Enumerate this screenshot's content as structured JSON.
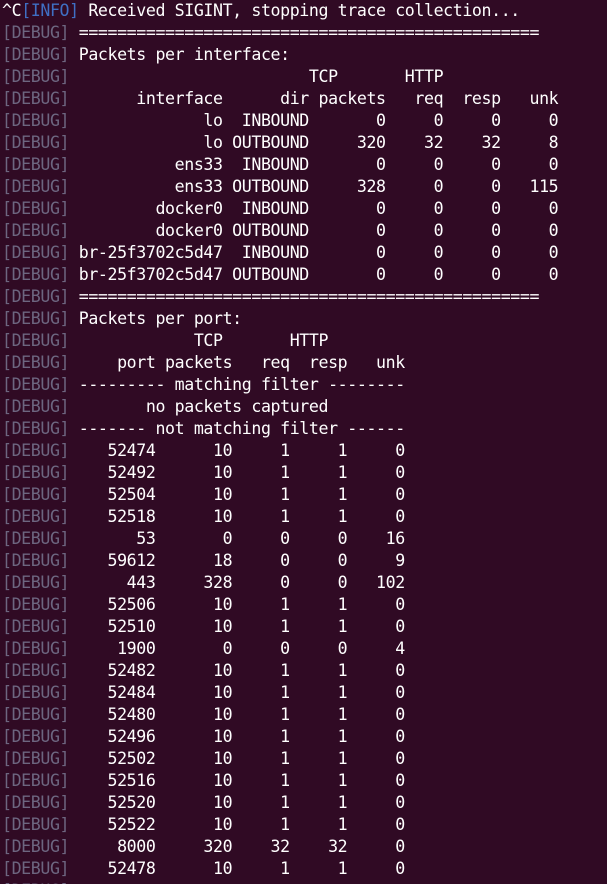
{
  "terminal": {
    "colors": {
      "background": "#300a24",
      "text": "#ffffff",
      "debug_tag": "#6d6680",
      "info_tag": "#3f6fc4"
    },
    "lines": [
      {
        "prefix": "^C",
        "tag": "[INFO]",
        "level": "info",
        "text": " Received SIGINT, stopping trace collection..."
      },
      {
        "prefix": "",
        "tag": "[DEBUG]",
        "level": "debug",
        "text": " ================================================"
      },
      {
        "prefix": "",
        "tag": "[DEBUG]",
        "level": "debug",
        "text": " Packets per interface:"
      },
      {
        "prefix": "",
        "tag": "[DEBUG]",
        "level": "debug",
        "text": "                         TCP       HTTP"
      },
      {
        "prefix": "",
        "tag": "[DEBUG]",
        "level": "debug",
        "text": "       interface      dir packets   req  resp   unk"
      },
      {
        "prefix": "",
        "tag": "[DEBUG]",
        "level": "debug",
        "text": "              lo  INBOUND       0     0     0     0"
      },
      {
        "prefix": "",
        "tag": "[DEBUG]",
        "level": "debug",
        "text": "              lo OUTBOUND     320    32    32     8"
      },
      {
        "prefix": "",
        "tag": "[DEBUG]",
        "level": "debug",
        "text": "           ens33  INBOUND       0     0     0     0"
      },
      {
        "prefix": "",
        "tag": "[DEBUG]",
        "level": "debug",
        "text": "           ens33 OUTBOUND     328     0     0   115"
      },
      {
        "prefix": "",
        "tag": "[DEBUG]",
        "level": "debug",
        "text": "         docker0  INBOUND       0     0     0     0"
      },
      {
        "prefix": "",
        "tag": "[DEBUG]",
        "level": "debug",
        "text": "         docker0 OUTBOUND       0     0     0     0"
      },
      {
        "prefix": "",
        "tag": "[DEBUG]",
        "level": "debug",
        "text": " br-25f3702c5d47  INBOUND       0     0     0     0"
      },
      {
        "prefix": "",
        "tag": "[DEBUG]",
        "level": "debug",
        "text": " br-25f3702c5d47 OUTBOUND       0     0     0     0"
      },
      {
        "prefix": "",
        "tag": "[DEBUG]",
        "level": "debug",
        "text": " ================================================"
      },
      {
        "prefix": "",
        "tag": "[DEBUG]",
        "level": "debug",
        "text": " Packets per port:"
      },
      {
        "prefix": "",
        "tag": "[DEBUG]",
        "level": "debug",
        "text": "             TCP       HTTP"
      },
      {
        "prefix": "",
        "tag": "[DEBUG]",
        "level": "debug",
        "text": "     port packets   req  resp   unk"
      },
      {
        "prefix": "",
        "tag": "[DEBUG]",
        "level": "debug",
        "text": " --------- matching filter --------"
      },
      {
        "prefix": "",
        "tag": "[DEBUG]",
        "level": "debug",
        "text": "        no packets captured"
      },
      {
        "prefix": "",
        "tag": "[DEBUG]",
        "level": "debug",
        "text": " ------- not matching filter ------"
      },
      {
        "prefix": "",
        "tag": "[DEBUG]",
        "level": "debug",
        "text": "    52474      10     1     1     0"
      },
      {
        "prefix": "",
        "tag": "[DEBUG]",
        "level": "debug",
        "text": "    52492      10     1     1     0"
      },
      {
        "prefix": "",
        "tag": "[DEBUG]",
        "level": "debug",
        "text": "    52504      10     1     1     0"
      },
      {
        "prefix": "",
        "tag": "[DEBUG]",
        "level": "debug",
        "text": "    52518      10     1     1     0"
      },
      {
        "prefix": "",
        "tag": "[DEBUG]",
        "level": "debug",
        "text": "       53       0     0     0    16"
      },
      {
        "prefix": "",
        "tag": "[DEBUG]",
        "level": "debug",
        "text": "    59612      18     0     0     9"
      },
      {
        "prefix": "",
        "tag": "[DEBUG]",
        "level": "debug",
        "text": "      443     328     0     0   102"
      },
      {
        "prefix": "",
        "tag": "[DEBUG]",
        "level": "debug",
        "text": "    52506      10     1     1     0"
      },
      {
        "prefix": "",
        "tag": "[DEBUG]",
        "level": "debug",
        "text": "    52510      10     1     1     0"
      },
      {
        "prefix": "",
        "tag": "[DEBUG]",
        "level": "debug",
        "text": "     1900       0     0     0     4"
      },
      {
        "prefix": "",
        "tag": "[DEBUG]",
        "level": "debug",
        "text": "    52482      10     1     1     0"
      },
      {
        "prefix": "",
        "tag": "[DEBUG]",
        "level": "debug",
        "text": "    52484      10     1     1     0"
      },
      {
        "prefix": "",
        "tag": "[DEBUG]",
        "level": "debug",
        "text": "    52480      10     1     1     0"
      },
      {
        "prefix": "",
        "tag": "[DEBUG]",
        "level": "debug",
        "text": "    52496      10     1     1     0"
      },
      {
        "prefix": "",
        "tag": "[DEBUG]",
        "level": "debug",
        "text": "    52502      10     1     1     0"
      },
      {
        "prefix": "",
        "tag": "[DEBUG]",
        "level": "debug",
        "text": "    52516      10     1     1     0"
      },
      {
        "prefix": "",
        "tag": "[DEBUG]",
        "level": "debug",
        "text": "    52520      10     1     1     0"
      },
      {
        "prefix": "",
        "tag": "[DEBUG]",
        "level": "debug",
        "text": "    52522      10     1     1     0"
      },
      {
        "prefix": "",
        "tag": "[DEBUG]",
        "level": "debug",
        "text": "     8000     320    32    32     0"
      },
      {
        "prefix": "",
        "tag": "[DEBUG]",
        "level": "debug",
        "text": "    52478      10     1     1     0"
      },
      {
        "prefix": "",
        "tag": "[DEBUG]",
        "level": "debug",
        "text": ""
      }
    ]
  }
}
